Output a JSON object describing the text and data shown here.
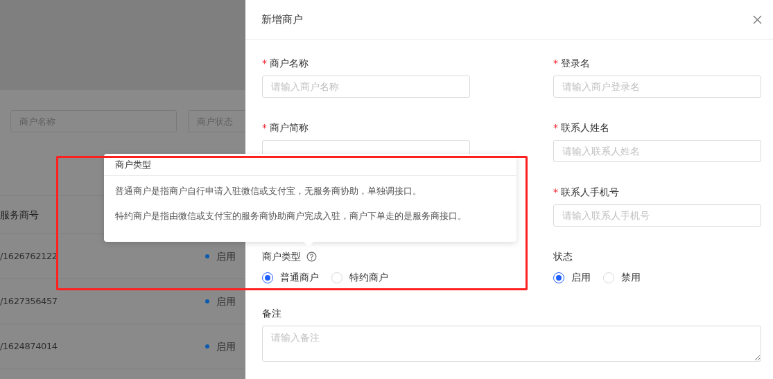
{
  "background": {
    "filters": [
      {
        "placeholder": "商户名称"
      },
      {
        "placeholder": "商户状态"
      }
    ],
    "table": {
      "columns": [
        "服务商号"
      ],
      "rows": [
        {
          "column_1": "/1626762122",
          "status": "启用",
          "color": "#0b5cad"
        },
        {
          "column_1": "/1627356457",
          "status": "启用",
          "color": "#0b5cad"
        },
        {
          "column_1": "/1624874014",
          "status": "启用",
          "color": "#0b5cad"
        }
      ]
    }
  },
  "drawer": {
    "title": "新增商户",
    "left_column": [
      {
        "kind": "input",
        "mark": "*",
        "label": "商户名称",
        "placeholder": "请输入商户名称"
      },
      {
        "kind": "input",
        "mark": "*",
        "label": "商户简称"
      },
      {
        "kind": "radio",
        "label": "商户类型",
        "help": true,
        "options": [
          {
            "label": "普通商户",
            "selected": true
          },
          {
            "label": "特约商户",
            "selected": false
          }
        ]
      }
    ],
    "right_column": [
      {
        "kind": "input",
        "mark": "*",
        "label": "登录名",
        "placeholder": "请输入商户登录名"
      },
      {
        "kind": "input",
        "mark": "*",
        "label": "联系人姓名",
        "placeholder": "请输入联系人姓名"
      },
      {
        "kind": "input",
        "mark": "*",
        "label": "联系人手机号",
        "placeholder": "请输入联系人手机号"
      },
      {
        "kind": "radio",
        "label": "状态",
        "help": false,
        "options": [
          {
            "label": "启用",
            "selected": true
          },
          {
            "label": "禁用",
            "selected": false
          }
        ]
      }
    ],
    "remark": {
      "kind": "textarea",
      "label": "备注",
      "placeholder": "请输入备注"
    }
  },
  "tooltip": {
    "title": "商户类型",
    "lines": [
      "普通商户是指商户自行申请入驻微信或支付宝，无服务商协助，单独调接口。",
      "特约商户是指由微信或支付宝的服务商协助商户完成入驻，商户下单走的是服务商接口。"
    ]
  }
}
